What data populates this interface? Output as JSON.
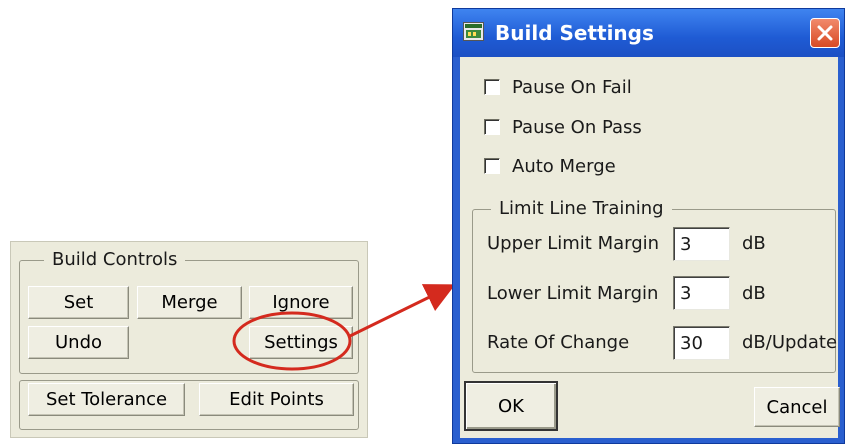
{
  "build_controls": {
    "group_title": "Build Controls",
    "buttons": {
      "set": "Set",
      "merge": "Merge",
      "ignore": "Ignore",
      "undo": "Undo",
      "settings": "Settings",
      "set_tolerance": "Set Tolerance",
      "edit_points": "Edit Points"
    }
  },
  "dialog": {
    "title": "Build Settings",
    "checkboxes": {
      "pause_on_fail": "Pause On Fail",
      "pause_on_pass": "Pause On Pass",
      "auto_merge": "Auto Merge"
    },
    "limit_group": {
      "title": "Limit Line Training",
      "upper": {
        "label": "Upper Limit Margin",
        "value": "3",
        "unit": "dB"
      },
      "lower": {
        "label": "Lower Limit Margin",
        "value": "3",
        "unit": "dB"
      },
      "rate": {
        "label": "Rate Of Change",
        "value": "30",
        "unit": "dB/Update"
      }
    },
    "ok_label": "OK",
    "cancel_label": "Cancel"
  },
  "colors": {
    "highlight_red": "#d42a1e",
    "title_blue": "#2a5fcf",
    "panel_beige": "#ecebdc"
  }
}
